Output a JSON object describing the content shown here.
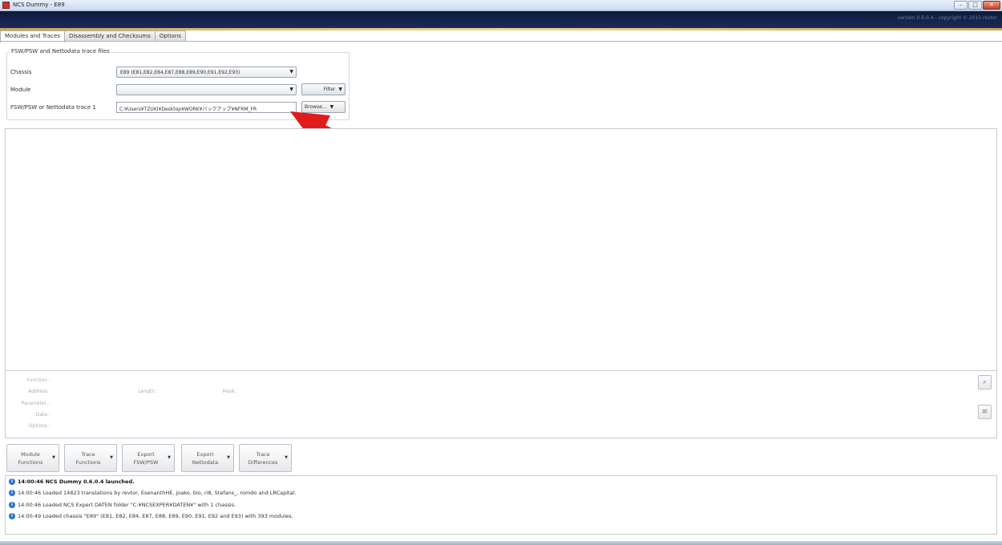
{
  "window": {
    "title": "NCS Dummy - E89",
    "minimize_label": "–",
    "maximize_label": "□",
    "close_label": "✕"
  },
  "banner": {
    "version_text": "version 0.6.0.4 - copyright © 2015 revtor"
  },
  "tabs": [
    {
      "label": "Modules and Traces",
      "active": true
    },
    {
      "label": "Disassembly and Checksums",
      "active": false
    },
    {
      "label": "Options",
      "active": false
    }
  ],
  "files_group": {
    "title": "FSW/PSW and Nettodata trace files",
    "chassis_label": "Chassis",
    "chassis_value": "E89 (E81,E82,E84,E87,E88,E89,E90,E91,E92,E93)",
    "module_label": "Module",
    "module_value": "",
    "filter_label": "Filter",
    "trace_label": "FSW/PSW or Nettodata trace 1",
    "trace_value": "C:¥Users¥TZUKI¥Desktop¥WORK¥バックアップ¥NFRM_FR",
    "browse_label": "Browse..."
  },
  "details": {
    "function_label": "Function :",
    "address_label": "Address :",
    "length_label": "Length :",
    "mask_label": "Mask :",
    "parameters_label": "Parameter...",
    "data_label": "Data :",
    "options_label": "Options :"
  },
  "toolbar": [
    {
      "line1": "Module",
      "line2": "Functions"
    },
    {
      "line1": "Trace",
      "line2": "Functions"
    },
    {
      "line1": "Export",
      "line2": "FSW/PSW"
    },
    {
      "line1": "Export",
      "line2": "Nettodata"
    },
    {
      "line1": "Trace",
      "line2": "Differences"
    }
  ],
  "log": [
    {
      "text": "14:00:46  NCS Dummy 0.6.0.4 launched.",
      "bold": true
    },
    {
      "text": "14:00:46  Loaded 14823 translations by revtor, EsenanthHE, joako, bio, ri8, Stefans_, romdo and LRCapital.",
      "bold": false
    },
    {
      "text": "14:00:46  Loaded NCS Expert DATEN folder \"C:¥NCSEXPER¥DATEN¥\" with 1 chassis.",
      "bold": false
    },
    {
      "text": "14:00:49  Loaded chassis \"E89\" (E81, E82, E84, E87, E88, E89, E90, E91, E92 and E93) with 393 modules.",
      "bold": false
    }
  ],
  "colors": {
    "annotation_arrow": "#e11b1b",
    "banner": "#13214a",
    "info_icon": "#2e6fd1"
  }
}
